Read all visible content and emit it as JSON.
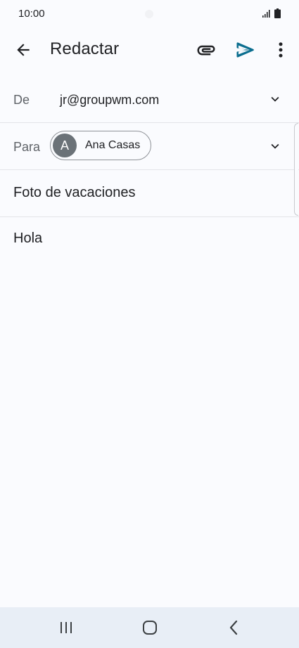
{
  "status_bar": {
    "time": "10:00",
    "icons": [
      "signal-icon",
      "battery-icon"
    ]
  },
  "app_bar": {
    "title": "Redactar",
    "icons": [
      "back-arrow-icon",
      "paperclip-icon",
      "send-icon",
      "more-vert-icon"
    ],
    "send_color": "#0b6e8f"
  },
  "compose": {
    "from_label": "De",
    "from_value": "jr@groupwm.com",
    "to_label": "Para",
    "recipient": {
      "initial": "A",
      "name": "Ana Casas"
    },
    "subject": "Foto de vacaciones",
    "body": "Hola"
  },
  "nav_bar": {
    "icons": [
      "recents-icon",
      "home-icon",
      "back-icon"
    ]
  },
  "colors": {
    "background": "#fafbfe",
    "nav_background": "#e8eef6",
    "avatar": "#6b7278",
    "text": "#202124",
    "label": "#5f6368"
  }
}
